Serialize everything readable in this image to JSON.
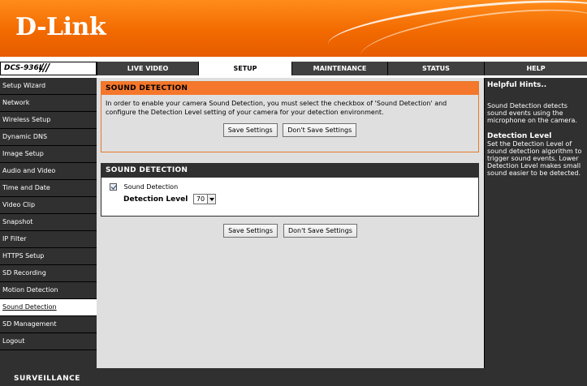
{
  "brand": {
    "logo": "D-Link",
    "model": "DCS-936L",
    "slashes": "///"
  },
  "nav": {
    "tabs": [
      {
        "label": "LIVE VIDEO"
      },
      {
        "label": "SETUP"
      },
      {
        "label": "MAINTENANCE"
      },
      {
        "label": "STATUS"
      },
      {
        "label": "HELP"
      }
    ]
  },
  "sidebar": {
    "items": [
      {
        "label": "Setup Wizard"
      },
      {
        "label": "Network"
      },
      {
        "label": "Wireless Setup"
      },
      {
        "label": "Dynamic DNS"
      },
      {
        "label": "Image Setup"
      },
      {
        "label": "Audio and Video"
      },
      {
        "label": "Time and Date"
      },
      {
        "label": "Video Clip"
      },
      {
        "label": "Snapshot"
      },
      {
        "label": "IP Filter"
      },
      {
        "label": "HTTPS Setup"
      },
      {
        "label": "SD Recording"
      },
      {
        "label": "Motion Detection"
      },
      {
        "label": "Sound Detection"
      },
      {
        "label": "SD Management"
      },
      {
        "label": "Logout"
      }
    ]
  },
  "intro": {
    "title": "SOUND DETECTION",
    "text": "In order to enable your camera Sound Detection, you must select the checkbox of 'Sound Detection' and configure the Detection Level setting of your camera for your detection environment.",
    "save": "Save Settings",
    "dont_save": "Don't Save Settings"
  },
  "settings": {
    "title": "SOUND DETECTION",
    "checkbox_label": "Sound Detection",
    "level_label": "Detection Level",
    "level_value": "70"
  },
  "bottom_buttons": {
    "save": "Save Settings",
    "dont_save": "Don't Save Settings"
  },
  "help": {
    "title": "Helpful Hints..",
    "text1": "Sound Detection detects sound events using the microphone on the camera.",
    "subtitle": "Detection Level",
    "text2": "Set the Detection Level of sound detection algorithm to trigger sound events. Lower Detection Level makes small sound easier to be detected."
  },
  "footer": {
    "label": "SURVEILLANCE"
  }
}
